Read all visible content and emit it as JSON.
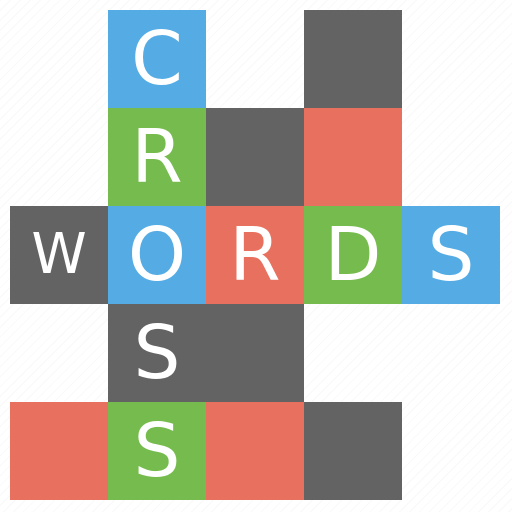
{
  "colors": {
    "blue": "#55ace4",
    "green": "#76bb4d",
    "red": "#e8705f",
    "gray": "#636363",
    "background": "#ffffff"
  },
  "cells": [
    {
      "row": 0,
      "col": 1,
      "color": "blue",
      "letter": "C"
    },
    {
      "row": 0,
      "col": 3,
      "color": "gray",
      "letter": ""
    },
    {
      "row": 1,
      "col": 1,
      "color": "green",
      "letter": "R"
    },
    {
      "row": 1,
      "col": 2,
      "color": "gray",
      "letter": ""
    },
    {
      "row": 1,
      "col": 3,
      "color": "red",
      "letter": ""
    },
    {
      "row": 2,
      "col": 0,
      "color": "gray",
      "letter": "W"
    },
    {
      "row": 2,
      "col": 1,
      "color": "blue",
      "letter": "O"
    },
    {
      "row": 2,
      "col": 2,
      "color": "red",
      "letter": "R"
    },
    {
      "row": 2,
      "col": 3,
      "color": "green",
      "letter": "D"
    },
    {
      "row": 2,
      "col": 4,
      "color": "blue",
      "letter": "S"
    },
    {
      "row": 3,
      "col": 1,
      "color": "gray",
      "letter": "S"
    },
    {
      "row": 3,
      "col": 2,
      "color": "gray",
      "letter": ""
    },
    {
      "row": 4,
      "col": 0,
      "color": "red",
      "letter": ""
    },
    {
      "row": 4,
      "col": 1,
      "color": "green",
      "letter": "S"
    },
    {
      "row": 4,
      "col": 2,
      "color": "red",
      "letter": ""
    },
    {
      "row": 4,
      "col": 3,
      "color": "gray",
      "letter": ""
    }
  ]
}
